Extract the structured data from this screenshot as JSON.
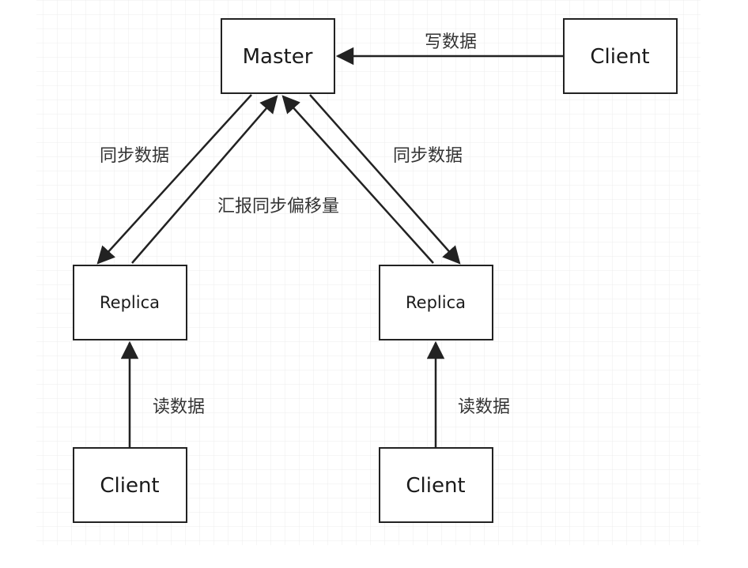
{
  "nodes": {
    "master": "Master",
    "client_write": "Client",
    "replica_left": "Replica",
    "replica_right": "Replica",
    "client_read_left": "Client",
    "client_read_right": "Client"
  },
  "edges": {
    "write_data": "写数据",
    "sync_data_left": "同步数据",
    "sync_data_right": "同步数据",
    "report_sync_offset": "汇报同步偏移量",
    "read_data_left": "读数据",
    "read_data_right": "读数据"
  },
  "colors": {
    "grid": "#e6e6e6",
    "stroke": "#222222",
    "text": "#1a1a1a"
  }
}
